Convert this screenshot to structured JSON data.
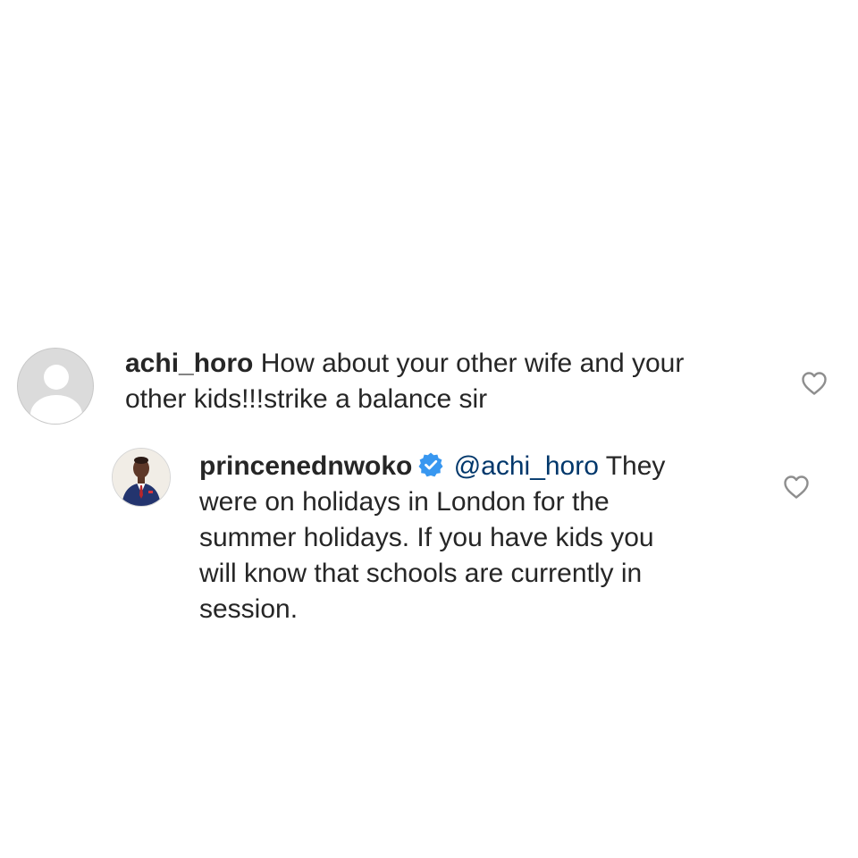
{
  "comments": [
    {
      "username": "achi_horo",
      "line1": "How about your other wife and your",
      "line2": "other kids!!!strike a balance sir",
      "avatar_icon": "default-avatar-icon",
      "like_icon": "heart-outline-icon"
    },
    {
      "username": "princenednwoko",
      "verified_icon": "verified-badge-icon",
      "mention": "@achi_horo",
      "line1_rest": "They",
      "line2": "were on holidays in London for the",
      "line3": "summer holidays. If you have kids you",
      "line4": "will know that schools are currently in",
      "line5": "session.",
      "avatar_icon": "profile-photo",
      "like_icon": "heart-outline-icon"
    }
  ],
  "colors": {
    "text": "#262626",
    "mention": "#00376b",
    "verified": "#3897f0",
    "heart_stroke": "#8e8e8e"
  }
}
